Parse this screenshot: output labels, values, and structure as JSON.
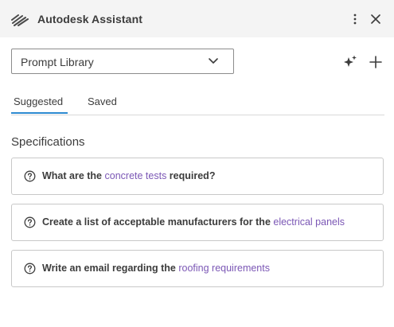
{
  "app": {
    "title": "Autodesk Assistant",
    "logo_icon": "autodesk-stripes-logo",
    "more_icon": "vertical-ellipsis-icon",
    "close_icon": "close-icon"
  },
  "library": {
    "selected": "Prompt Library",
    "chevron_icon": "chevron-down-icon",
    "sparkle_icon": "sparkle-icon",
    "add_icon": "plus-icon"
  },
  "tabs": [
    {
      "label": "Suggested",
      "active": true
    },
    {
      "label": "Saved",
      "active": false
    }
  ],
  "section": {
    "title": "Specifications"
  },
  "prompts": [
    {
      "before": "What are the ",
      "highlight": "concrete tests",
      "after": " required?"
    },
    {
      "before": "Create a list of acceptable manufacturers for the ",
      "highlight": "electrical panels",
      "after": ""
    },
    {
      "before": "Write an email regarding the ",
      "highlight": "roofing requirements",
      "after": ""
    }
  ],
  "colors": {
    "accent_tab": "#2d8ad0",
    "highlight": "#7b57b5",
    "header_bg": "#f4f4f4"
  }
}
